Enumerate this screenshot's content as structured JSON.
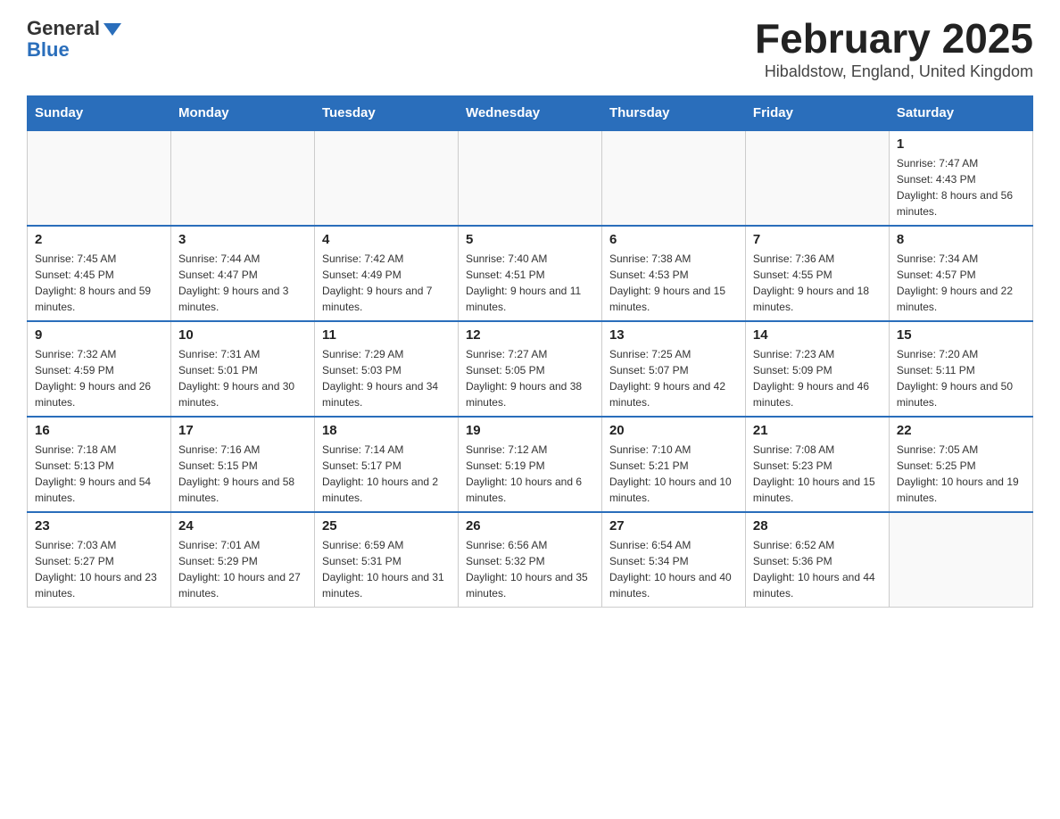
{
  "header": {
    "logo_general": "General",
    "logo_blue": "Blue",
    "title": "February 2025",
    "subtitle": "Hibaldstow, England, United Kingdom"
  },
  "days_of_week": [
    "Sunday",
    "Monday",
    "Tuesday",
    "Wednesday",
    "Thursday",
    "Friday",
    "Saturday"
  ],
  "weeks": [
    [
      {
        "day": "",
        "info": ""
      },
      {
        "day": "",
        "info": ""
      },
      {
        "day": "",
        "info": ""
      },
      {
        "day": "",
        "info": ""
      },
      {
        "day": "",
        "info": ""
      },
      {
        "day": "",
        "info": ""
      },
      {
        "day": "1",
        "info": "Sunrise: 7:47 AM\nSunset: 4:43 PM\nDaylight: 8 hours and 56 minutes."
      }
    ],
    [
      {
        "day": "2",
        "info": "Sunrise: 7:45 AM\nSunset: 4:45 PM\nDaylight: 8 hours and 59 minutes."
      },
      {
        "day": "3",
        "info": "Sunrise: 7:44 AM\nSunset: 4:47 PM\nDaylight: 9 hours and 3 minutes."
      },
      {
        "day": "4",
        "info": "Sunrise: 7:42 AM\nSunset: 4:49 PM\nDaylight: 9 hours and 7 minutes."
      },
      {
        "day": "5",
        "info": "Sunrise: 7:40 AM\nSunset: 4:51 PM\nDaylight: 9 hours and 11 minutes."
      },
      {
        "day": "6",
        "info": "Sunrise: 7:38 AM\nSunset: 4:53 PM\nDaylight: 9 hours and 15 minutes."
      },
      {
        "day": "7",
        "info": "Sunrise: 7:36 AM\nSunset: 4:55 PM\nDaylight: 9 hours and 18 minutes."
      },
      {
        "day": "8",
        "info": "Sunrise: 7:34 AM\nSunset: 4:57 PM\nDaylight: 9 hours and 22 minutes."
      }
    ],
    [
      {
        "day": "9",
        "info": "Sunrise: 7:32 AM\nSunset: 4:59 PM\nDaylight: 9 hours and 26 minutes."
      },
      {
        "day": "10",
        "info": "Sunrise: 7:31 AM\nSunset: 5:01 PM\nDaylight: 9 hours and 30 minutes."
      },
      {
        "day": "11",
        "info": "Sunrise: 7:29 AM\nSunset: 5:03 PM\nDaylight: 9 hours and 34 minutes."
      },
      {
        "day": "12",
        "info": "Sunrise: 7:27 AM\nSunset: 5:05 PM\nDaylight: 9 hours and 38 minutes."
      },
      {
        "day": "13",
        "info": "Sunrise: 7:25 AM\nSunset: 5:07 PM\nDaylight: 9 hours and 42 minutes."
      },
      {
        "day": "14",
        "info": "Sunrise: 7:23 AM\nSunset: 5:09 PM\nDaylight: 9 hours and 46 minutes."
      },
      {
        "day": "15",
        "info": "Sunrise: 7:20 AM\nSunset: 5:11 PM\nDaylight: 9 hours and 50 minutes."
      }
    ],
    [
      {
        "day": "16",
        "info": "Sunrise: 7:18 AM\nSunset: 5:13 PM\nDaylight: 9 hours and 54 minutes."
      },
      {
        "day": "17",
        "info": "Sunrise: 7:16 AM\nSunset: 5:15 PM\nDaylight: 9 hours and 58 minutes."
      },
      {
        "day": "18",
        "info": "Sunrise: 7:14 AM\nSunset: 5:17 PM\nDaylight: 10 hours and 2 minutes."
      },
      {
        "day": "19",
        "info": "Sunrise: 7:12 AM\nSunset: 5:19 PM\nDaylight: 10 hours and 6 minutes."
      },
      {
        "day": "20",
        "info": "Sunrise: 7:10 AM\nSunset: 5:21 PM\nDaylight: 10 hours and 10 minutes."
      },
      {
        "day": "21",
        "info": "Sunrise: 7:08 AM\nSunset: 5:23 PM\nDaylight: 10 hours and 15 minutes."
      },
      {
        "day": "22",
        "info": "Sunrise: 7:05 AM\nSunset: 5:25 PM\nDaylight: 10 hours and 19 minutes."
      }
    ],
    [
      {
        "day": "23",
        "info": "Sunrise: 7:03 AM\nSunset: 5:27 PM\nDaylight: 10 hours and 23 minutes."
      },
      {
        "day": "24",
        "info": "Sunrise: 7:01 AM\nSunset: 5:29 PM\nDaylight: 10 hours and 27 minutes."
      },
      {
        "day": "25",
        "info": "Sunrise: 6:59 AM\nSunset: 5:31 PM\nDaylight: 10 hours and 31 minutes."
      },
      {
        "day": "26",
        "info": "Sunrise: 6:56 AM\nSunset: 5:32 PM\nDaylight: 10 hours and 35 minutes."
      },
      {
        "day": "27",
        "info": "Sunrise: 6:54 AM\nSunset: 5:34 PM\nDaylight: 10 hours and 40 minutes."
      },
      {
        "day": "28",
        "info": "Sunrise: 6:52 AM\nSunset: 5:36 PM\nDaylight: 10 hours and 44 minutes."
      },
      {
        "day": "",
        "info": ""
      }
    ]
  ]
}
